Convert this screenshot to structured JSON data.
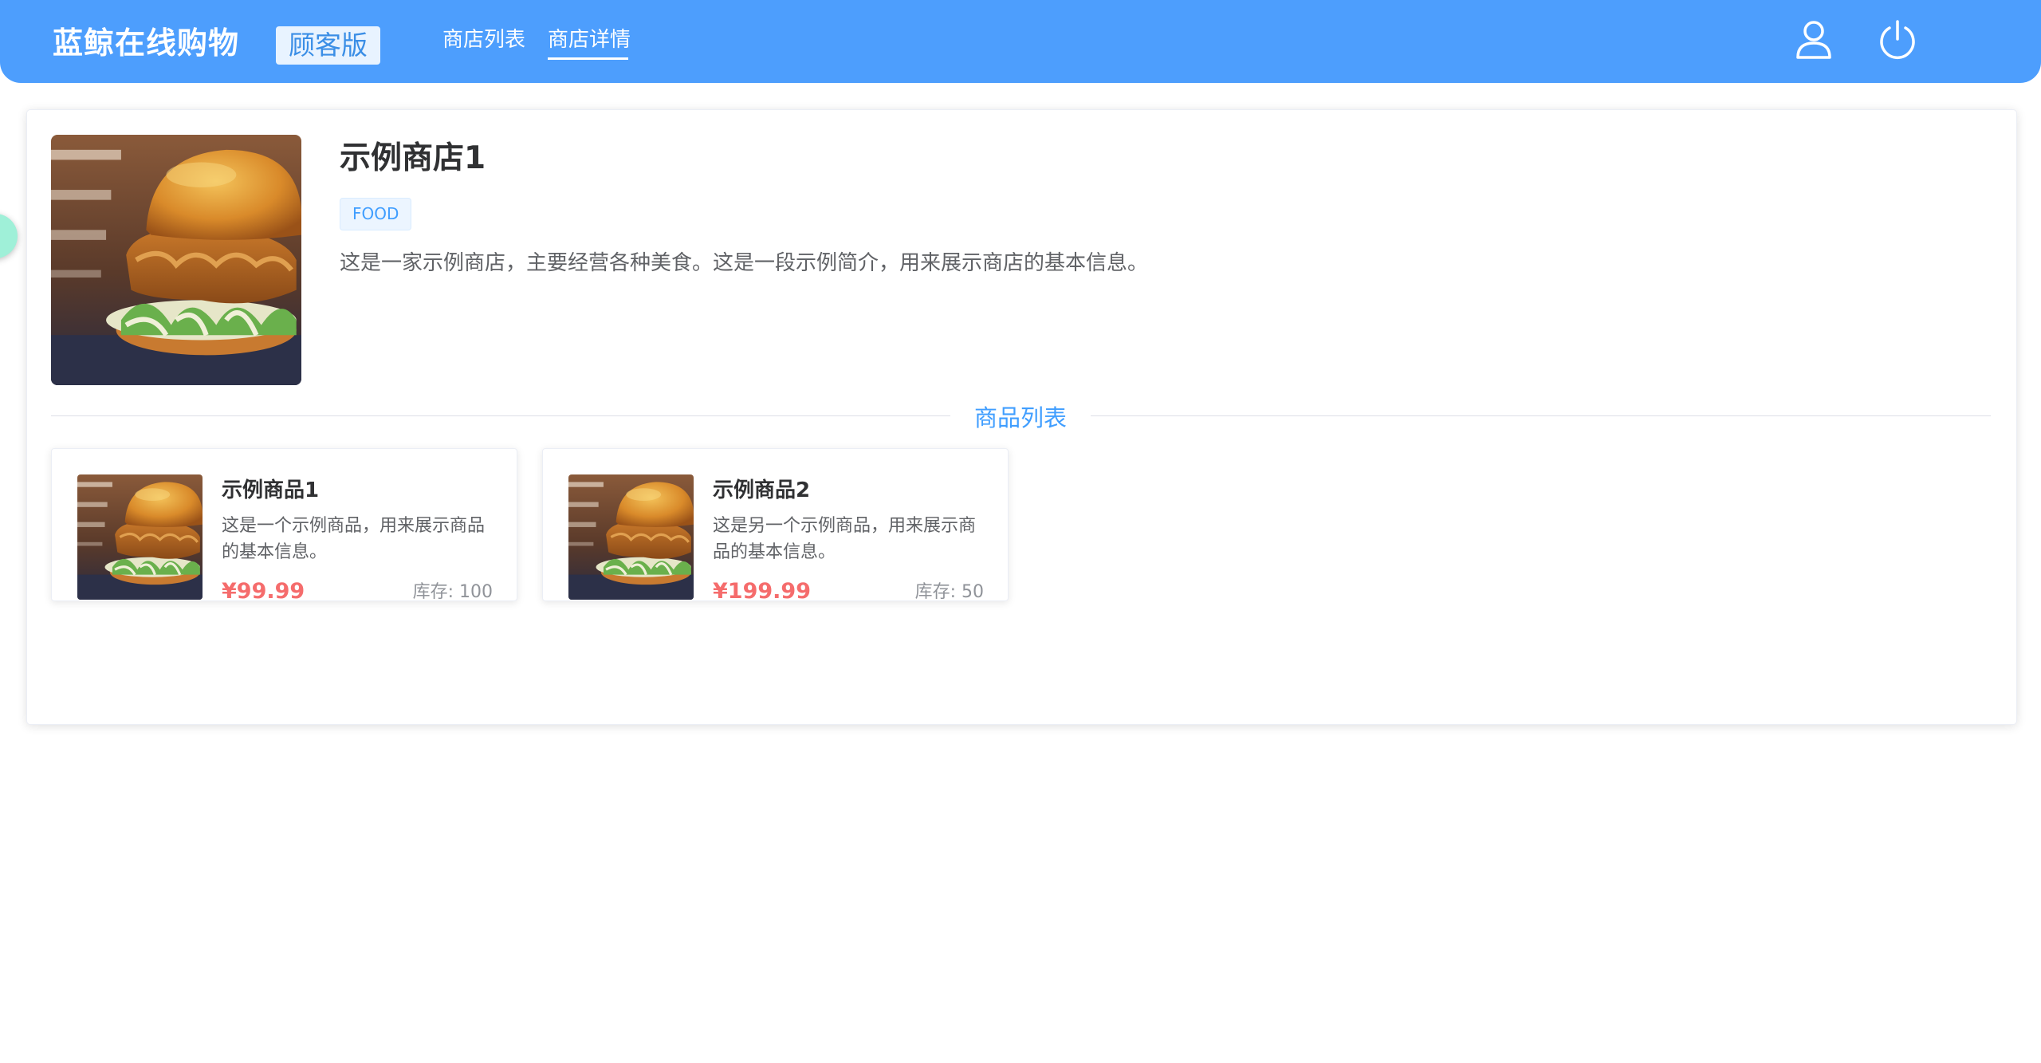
{
  "header": {
    "logo": "蓝鲸在线购物",
    "edition": "顾客版",
    "nav": [
      {
        "label": "商店列表"
      },
      {
        "label": "商店详情"
      }
    ],
    "active_nav": "商店详情",
    "icons": [
      "user-icon",
      "power-icon"
    ],
    "bg_color": "#4d9efd"
  },
  "shop": {
    "name": "示例商店1",
    "tag": "FOOD",
    "description": "这是一家示例商店，主要经营各种美食。这是一段示例简介，用来展示商店的基本信息。",
    "image": "burger-photo"
  },
  "section": {
    "title": "商品列表"
  },
  "products": [
    {
      "name": "示例商品1",
      "description": "这是一个示例商品，用来展示商品的基本信息。",
      "price": "¥99.99",
      "stock": "库存: 100",
      "image": "burger-photo"
    },
    {
      "name": "示例商品2",
      "description": "这是另一个示例商品，用来展示商品的基本信息。",
      "price": "¥199.99",
      "stock": "库存: 50",
      "image": "burger-photo"
    }
  ],
  "colors": {
    "accent": "#409eff",
    "price": "#f56c6c"
  }
}
